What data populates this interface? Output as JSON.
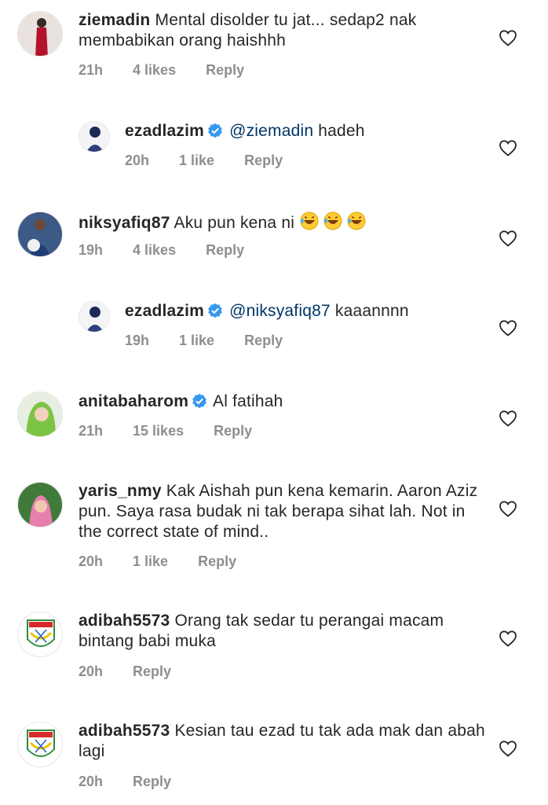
{
  "comments": [
    {
      "username": "ziemadin",
      "text": "Mental disolder tu jat... sedap2 nak membabikan orang haishhh",
      "time": "21h",
      "likes": "4 likes",
      "reply": "Reply"
    },
    {
      "username": "ezadlazim",
      "mention": "@ziemadin",
      "text": "hadeh",
      "time": "20h",
      "likes": "1 like",
      "reply": "Reply"
    },
    {
      "username": "niksyafiq87",
      "text": "Aku pun kena ni",
      "time": "19h",
      "likes": "4 likes",
      "reply": "Reply",
      "emoji": "rolling-on-floor-laughing"
    },
    {
      "username": "ezadlazim",
      "mention": "@niksyafiq87",
      "text": "kaaannnn",
      "time": "19h",
      "likes": "1 like",
      "reply": "Reply"
    },
    {
      "username": "anitabaharom",
      "text": "Al fatihah",
      "time": "21h",
      "likes": "15 likes",
      "reply": "Reply"
    },
    {
      "username": "yaris_nmy",
      "text": "Kak Aishah pun kena kemarin. Aaron Aziz pun. Saya rasa budak ni tak berapa sihat lah. Not in the correct state of mind..",
      "time": "20h",
      "likes": "1 like",
      "reply": "Reply"
    },
    {
      "username": "adibah5573",
      "text": "Orang tak sedar tu perangai macam bintang babi muka",
      "time": "20h",
      "reply": "Reply"
    },
    {
      "username": "adibah5573",
      "text": "Kesian tau ezad tu tak ada mak dan abah lagi",
      "time": "20h",
      "reply": "Reply"
    }
  ],
  "colors": {
    "text": "#262626",
    "meta": "#8e8e8e",
    "mention": "#003569",
    "verified": "#3897f0"
  },
  "icons": {
    "like": "heart-outline-icon",
    "verified": "verified-badge-icon"
  }
}
